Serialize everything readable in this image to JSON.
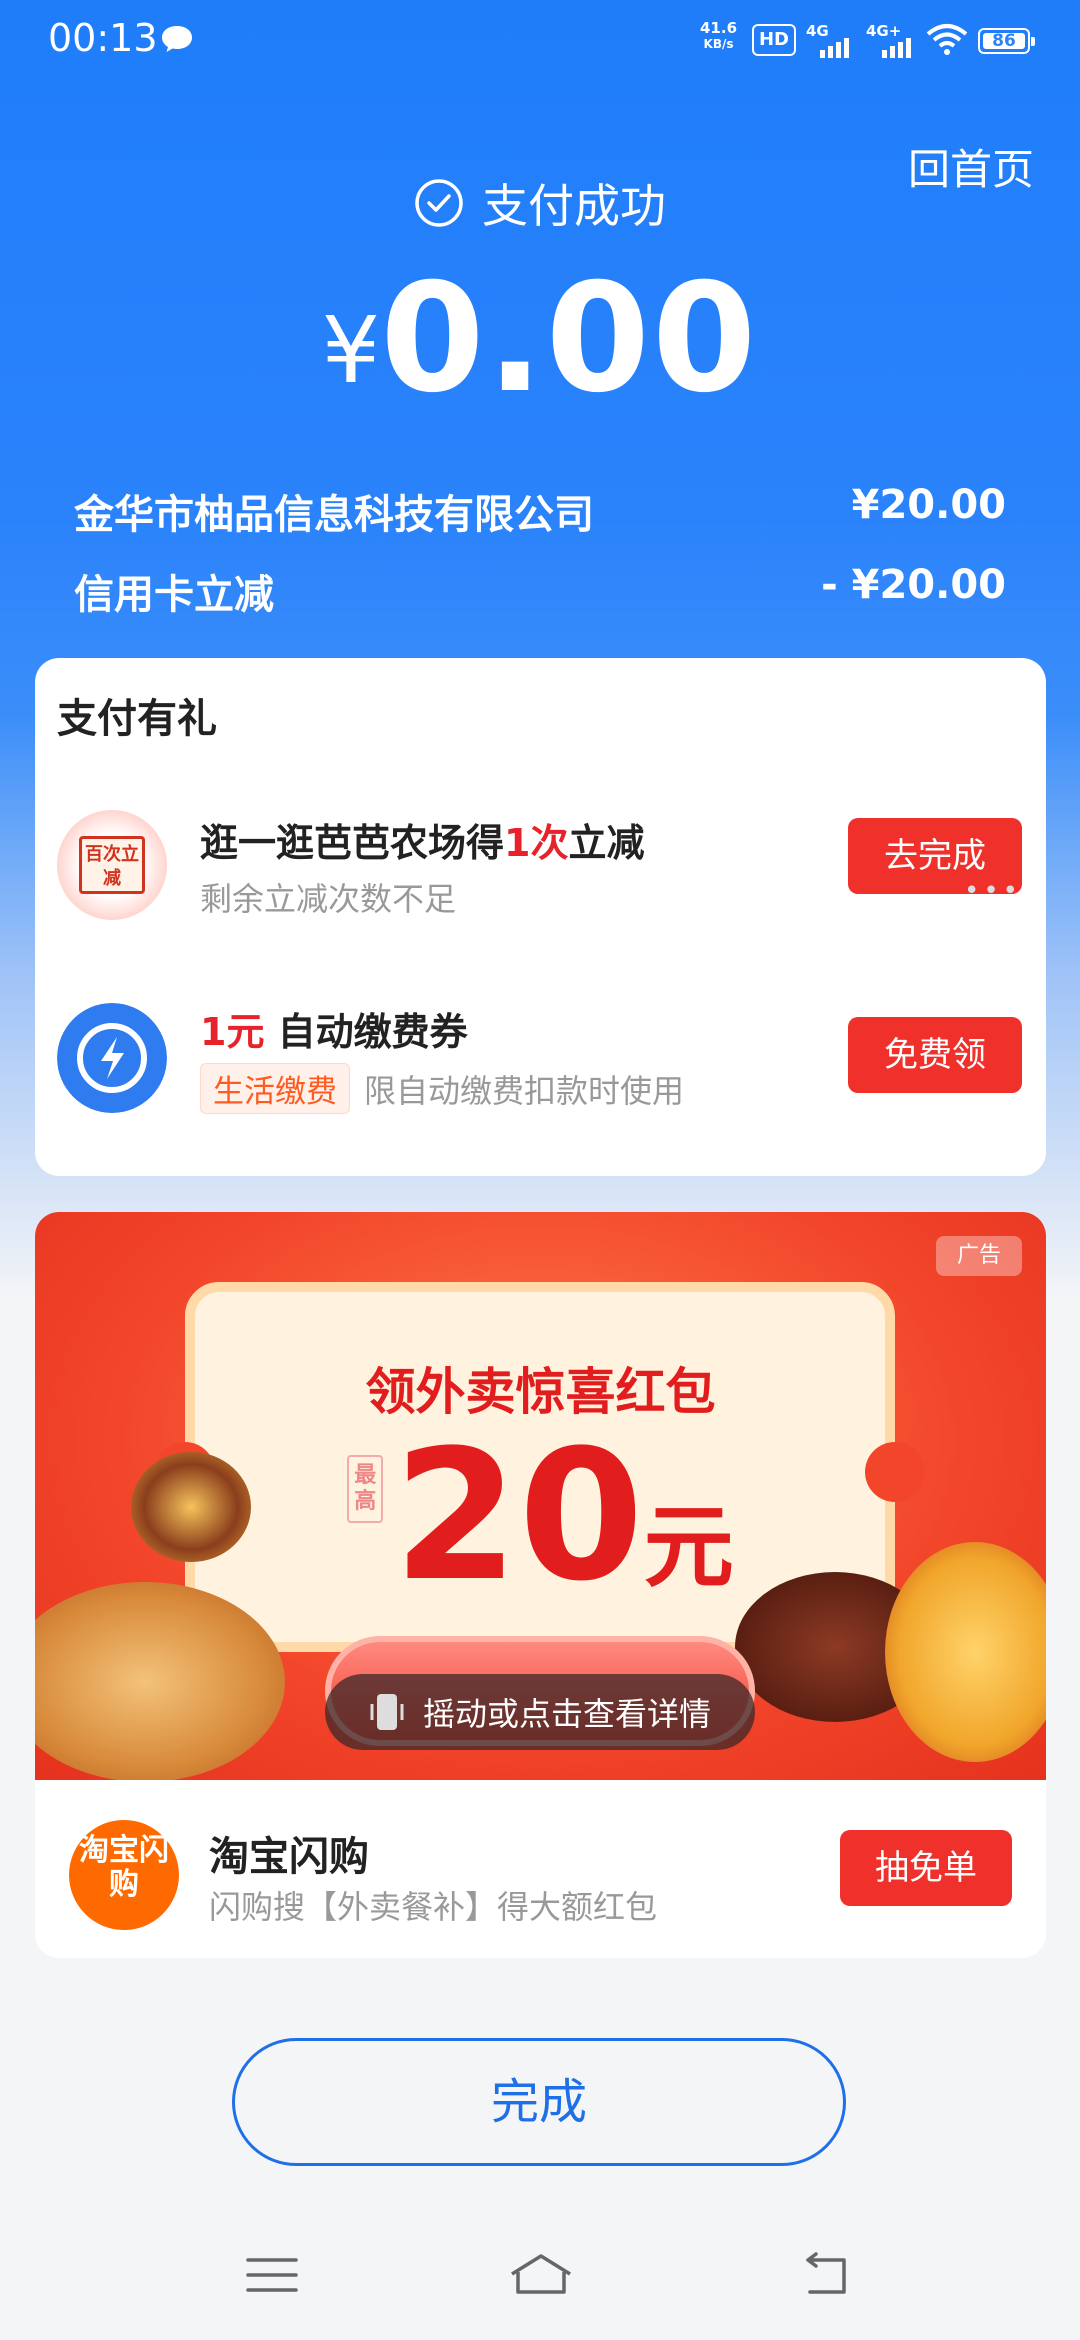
{
  "status_bar": {
    "time": "00:13",
    "net_speed_value": "41.6",
    "net_speed_unit": "KB/s",
    "hd_label": "HD",
    "signal1": "4G",
    "signal2": "4G+",
    "battery": "86"
  },
  "header": {
    "home_link": "回首页",
    "success_text": "支付成功",
    "currency": "¥",
    "amount": "0.00"
  },
  "summary": [
    {
      "label": "金华市柚品信息科技有限公司",
      "value": "¥20.00"
    },
    {
      "label": "信用卡立减",
      "value": "- ¥20.00"
    }
  ],
  "gift_card": {
    "title": "支付有礼",
    "tasks": [
      {
        "icon_text": "百次立减",
        "title_pre": "逛一逛芭芭农场得",
        "title_highlight": "1次",
        "title_post": "立减",
        "subtitle": "剩余立减次数不足",
        "button": "去完成"
      },
      {
        "title_highlight": "1元",
        "title_post": " 自动缴费券",
        "tag": "生活缴费",
        "subtitle": "限自动缴费扣款时使用",
        "button": "免费领"
      }
    ],
    "more_dots": "•••"
  },
  "ad": {
    "ad_tag": "广告",
    "headline": "领外卖惊喜红包",
    "prefix": "最高",
    "big_number": "20",
    "big_unit": "元",
    "cta_hint": "摇动或点击查看详情",
    "shop_logo_text": "淘宝闪购",
    "shop_name": "淘宝闪购",
    "shop_desc": "闪购搜【外卖餐补】得大额红包",
    "shop_button": "抽免单"
  },
  "done_button": "完成",
  "colors": {
    "primary_blue": "#1f7dfa",
    "accent_red": "#f0302b",
    "tag_orange": "#ff5a1f"
  }
}
